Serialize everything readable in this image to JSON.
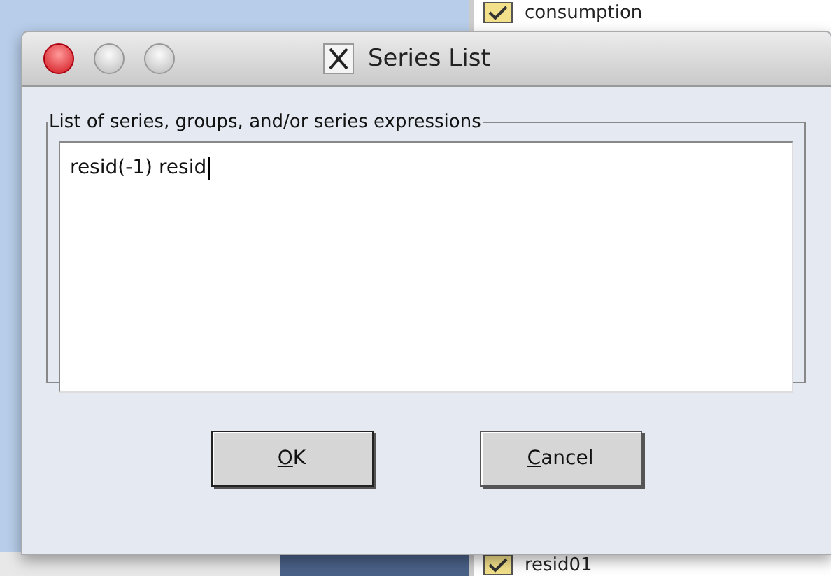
{
  "background": {
    "items": [
      {
        "label": "consumption"
      },
      {
        "label": "resid01"
      }
    ]
  },
  "dialog": {
    "title": "Series List",
    "group_label": "List of series, groups, and/or series expressions",
    "text_value": "resid(-1) resid",
    "buttons": [
      {
        "label": "OK",
        "default": true
      },
      {
        "label": "Cancel",
        "default": false
      }
    ]
  }
}
